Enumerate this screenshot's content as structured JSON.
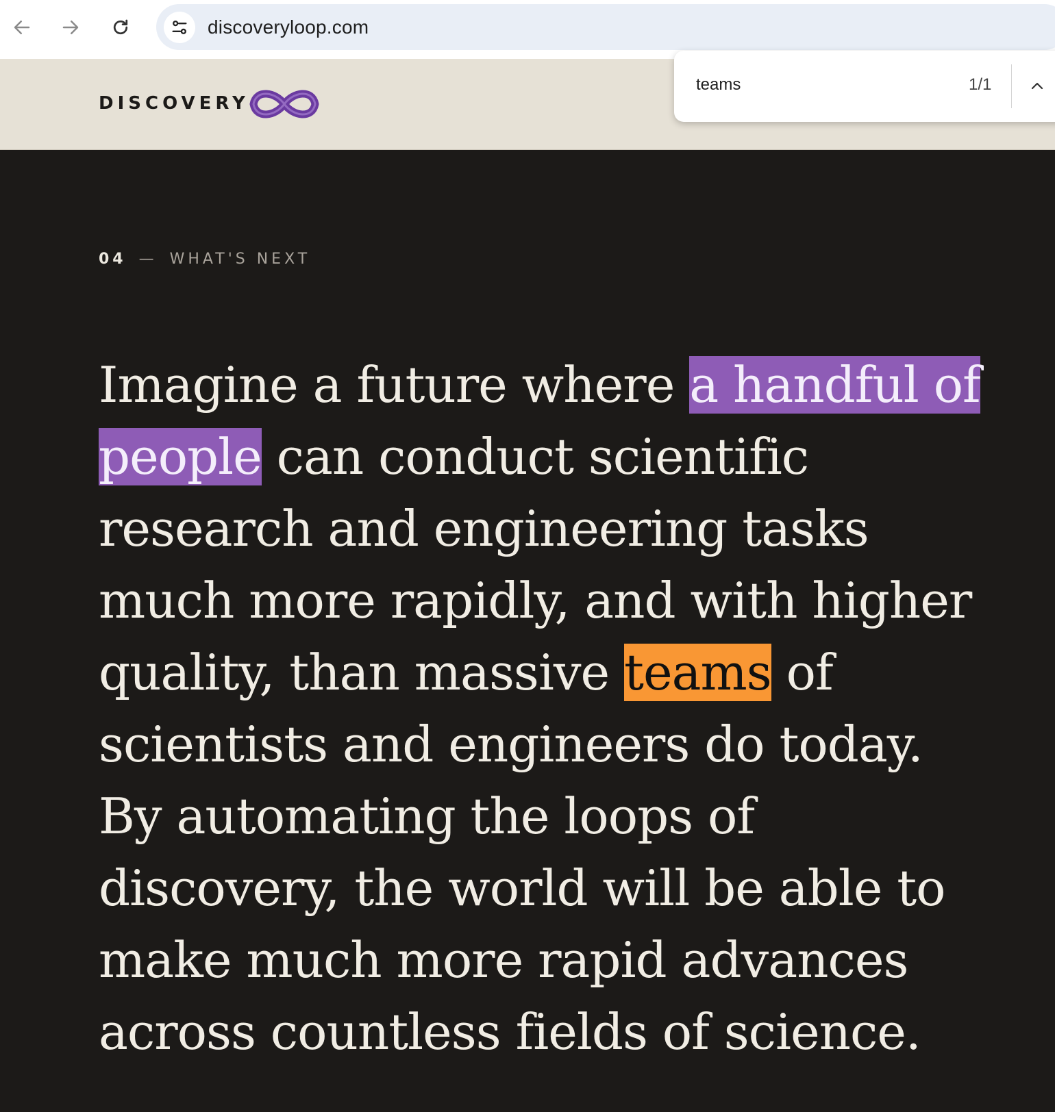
{
  "browser": {
    "url": "discoveryloop.com"
  },
  "site": {
    "brand": "DISCOVERY"
  },
  "find_bar": {
    "query": "teams",
    "match_count": "1/1"
  },
  "section": {
    "number": "04",
    "dash": "—",
    "title": "WHAT'S NEXT"
  },
  "paragraph": {
    "l1_pre": "Imagine a future where ",
    "l1_hl": "a handful of",
    "l2_hl": "people",
    "l2_post": " can conduct scientific",
    "l3": "research and engineering tasks",
    "l4": "much more rapidly, and with higher",
    "l5_pre": "quality, than massive ",
    "l5_match": "teams",
    "l5_post": " of",
    "l6": "scientists and engineers do today.",
    "l7": "By automating the loops of",
    "l8": "discovery, the world will be able to",
    "l9": "make much more rapid advances",
    "l10": "across countless fields of science."
  },
  "colors": {
    "page_bg": "#1c1a18",
    "header_bg": "#e6e1d6",
    "highlight_purple": "#8e5cb6",
    "find_match_orange": "#f99734",
    "logo_purple": "#6a3aa0"
  },
  "icons": {
    "back": "arrow-left-icon",
    "forward": "arrow-right-icon",
    "reload": "reload-icon",
    "site_info": "tune-icon",
    "logo": "infinity-icon",
    "find_prev": "chevron-up-icon"
  }
}
